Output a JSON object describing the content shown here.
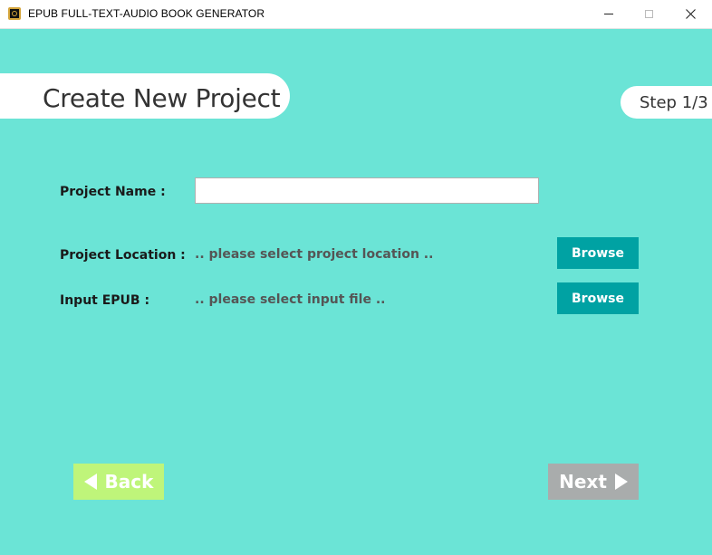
{
  "window": {
    "title": "EPUB FULL-TEXT-AUDIO BOOK GENERATOR",
    "icon": "headphones-book-icon",
    "controls": {
      "minimize": "minimize-icon",
      "maximize": "maximize-icon",
      "close": "close-icon"
    }
  },
  "header": {
    "title": "Create New Project",
    "step": "Step 1/3"
  },
  "form": {
    "project_name": {
      "label": "Project Name :",
      "value": "",
      "placeholder": ""
    },
    "project_location": {
      "label": "Project Location :",
      "value": ".. please select project location ..",
      "browse_label": "Browse"
    },
    "input_epub": {
      "label": "Input EPUB :",
      "value": ".. please select input file ..",
      "browse_label": "Browse"
    }
  },
  "navigation": {
    "back_label": "Back",
    "back_icon": "triangle-left-icon",
    "next_label": "Next",
    "next_icon": "triangle-right-icon",
    "next_enabled": false
  },
  "colors": {
    "background": "#6be4d6",
    "browse_button": "#00a2a3",
    "back_button": "#bff57a",
    "next_button_disabled": "#a9acac"
  }
}
